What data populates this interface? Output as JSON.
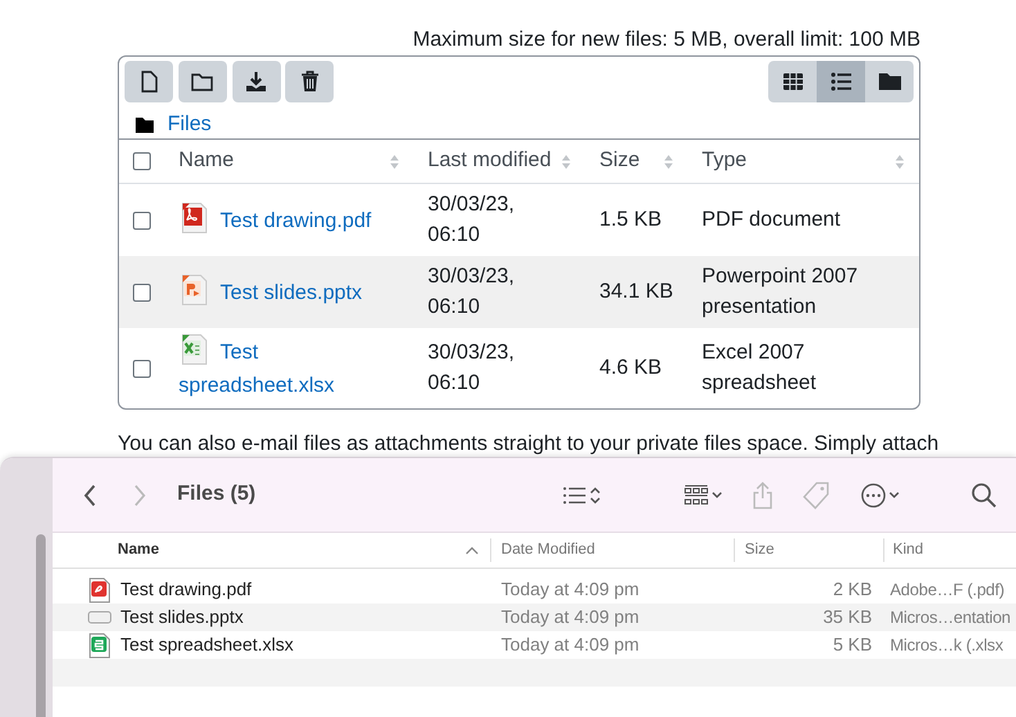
{
  "quota_note": "Maximum size for new files: 5 MB, overall limit: 100 MB",
  "file_manager": {
    "actions": [
      {
        "kind": "new-file"
      },
      {
        "kind": "new-folder"
      },
      {
        "kind": "download"
      },
      {
        "kind": "delete"
      }
    ],
    "view_modes": [
      {
        "kind": "grid",
        "selected": false
      },
      {
        "kind": "list",
        "selected": true
      },
      {
        "kind": "tree",
        "selected": false
      }
    ],
    "breadcrumb": "Files",
    "select_all_checked": false,
    "columns": [
      "Name",
      "Last modified",
      "Size",
      "Type"
    ],
    "rows": [
      {
        "kind": "pdf",
        "name": "Test drawing.pdf",
        "modified": "30/03/23, 06:10",
        "size": "1.5 KB",
        "type": "PDF document",
        "checked": false,
        "hovered": false
      },
      {
        "kind": "pptx",
        "name": "Test slides.pptx",
        "modified": "30/03/23, 06:10",
        "size": "34.1 KB",
        "type": "Powerpoint 2007 presentation",
        "checked": false,
        "hovered": true
      },
      {
        "kind": "xlsx",
        "name": "Test spreadsheet.xlsx",
        "modified": "30/03/23, 06:10",
        "size": "4.6 KB",
        "type": "Excel 2007 spreadsheet",
        "checked": false,
        "hovered": false
      }
    ]
  },
  "email_note": "You can also e-mail files as attachments straight to your private files space. Simply attach",
  "finder": {
    "title": "Files (5)",
    "columns": [
      "Name",
      "Date Modified",
      "Size",
      "Kind"
    ],
    "rows": [
      {
        "kind": "pdf",
        "name": "Test drawing.pdf",
        "date": "Today at 4:09 pm",
        "size": "2 KB",
        "kind_label": "Adobe…F (.pdf)"
      },
      {
        "kind": "pptx",
        "name": "Test slides.pptx",
        "date": "Today at 4:09 pm",
        "size": "35 KB",
        "kind_label": "Micros…entation"
      },
      {
        "kind": "xlsx",
        "name": "Test spreadsheet.xlsx",
        "date": "Today at 4:09 pm",
        "size": "5 KB",
        "kind_label": "Micros…k (.xlsx"
      }
    ]
  }
}
